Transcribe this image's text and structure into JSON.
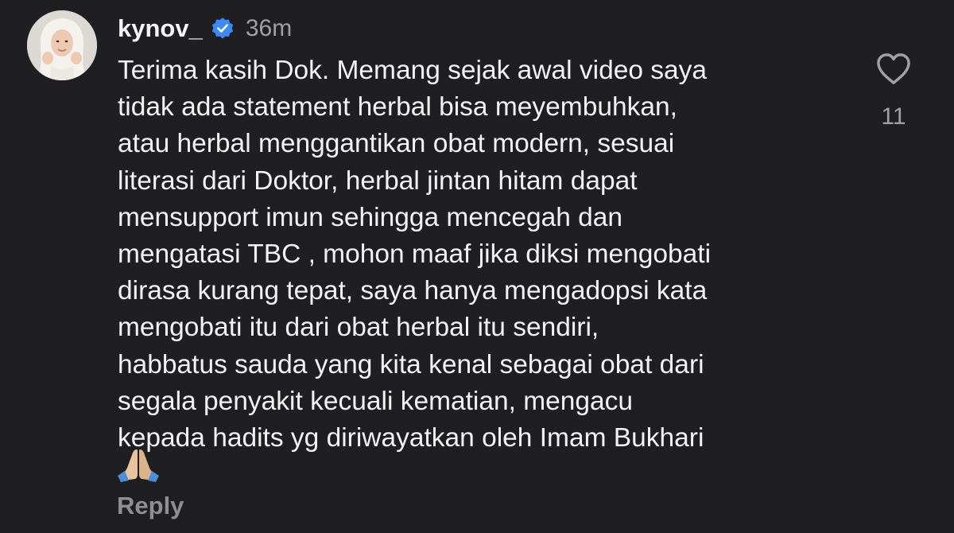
{
  "comment": {
    "username": "kynov_",
    "timestamp": "36m",
    "verified_icon": "verified-badge-icon",
    "avatar_icon": "profile-avatar",
    "body_lines": [
      "Terima kasih Dok. Memang sejak awal video saya",
      "tidak ada statement herbal bisa meyembuhkan,",
      "atau herbal menggantikan obat modern, sesuai",
      "literasi dari Doktor, herbal jintan hitam dapat",
      "mensupport imun sehingga mencegah dan",
      "mengatasi TBC , mohon maaf jika diksi mengobati",
      "dirasa kurang tepat, saya hanya mengadopsi kata",
      "mengobati itu dari obat herbal itu sendiri,",
      "habbatus sauda yang kita kenal sebagai obat dari",
      "segala penyakit kecuali kematian, mengacu",
      "kepada hadits yg diriwayatkan oleh Imam Bukhari"
    ],
    "emoji": "🙏",
    "emoji_icon": "folded-hands-emoji",
    "reply_label": "Reply",
    "like_icon": "heart-outline-icon",
    "like_count": "11"
  },
  "colors": {
    "background": "#1f1f21",
    "text": "#f2f2f2",
    "muted": "#a0a0a6",
    "reply": "#8e8e93",
    "verified": "#3d8af7"
  }
}
